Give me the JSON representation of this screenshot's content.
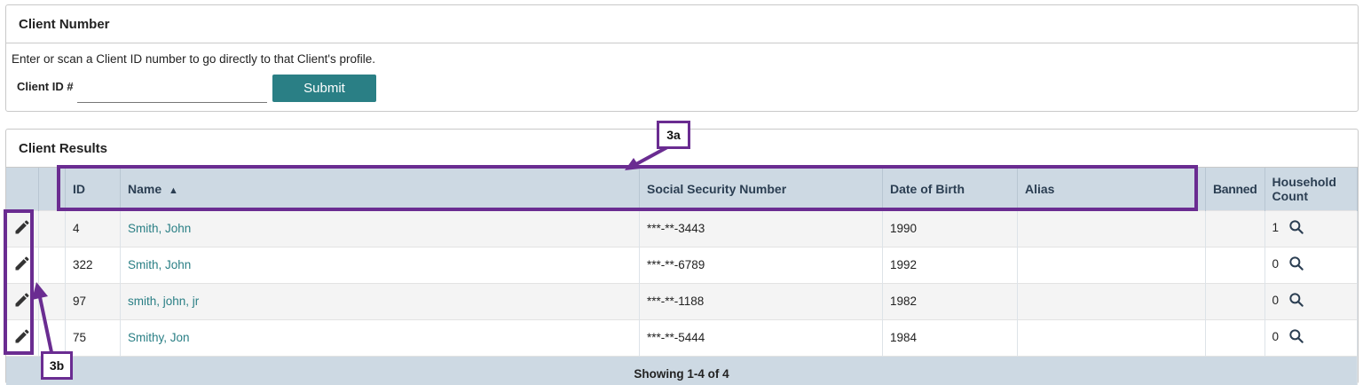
{
  "client_number_panel": {
    "title": "Client Number",
    "instructions": "Enter or scan a Client ID number to go directly to that Client's profile.",
    "client_id_label": "Client ID #",
    "client_id_value": "",
    "submit_label": "Submit"
  },
  "client_results_panel": {
    "title": "Client Results",
    "columns": {
      "id": "ID",
      "name": "Name",
      "ssn": "Social Security Number",
      "dob": "Date of Birth",
      "alias": "Alias",
      "banned": "Banned",
      "household": "Household Count"
    },
    "sort_indicator": "▲",
    "rows": [
      {
        "id": "4",
        "name": "Smith, John",
        "ssn": "***-**-3443",
        "dob": "1990",
        "alias": "",
        "banned": "",
        "household": "1"
      },
      {
        "id": "322",
        "name": "Smith, John",
        "ssn": "***-**-6789",
        "dob": "1992",
        "alias": "",
        "banned": "",
        "household": "0"
      },
      {
        "id": "97",
        "name": "smith, john, jr",
        "ssn": "***-**-1188",
        "dob": "1982",
        "alias": "",
        "banned": "",
        "household": "0"
      },
      {
        "id": "75",
        "name": "Smithy, Jon",
        "ssn": "***-**-5444",
        "dob": "1984",
        "alias": "",
        "banned": "",
        "household": "0"
      }
    ],
    "footer": "Showing 1-4 of 4"
  },
  "annotations": {
    "label_3a": "3a",
    "label_3b": "3b"
  },
  "icons": {
    "edit": "pencil-icon",
    "household_search": "search-icon"
  },
  "colors": {
    "accent": "#2a7f85",
    "header_bg": "#cdd9e3",
    "annotation": "#6a2c91"
  }
}
